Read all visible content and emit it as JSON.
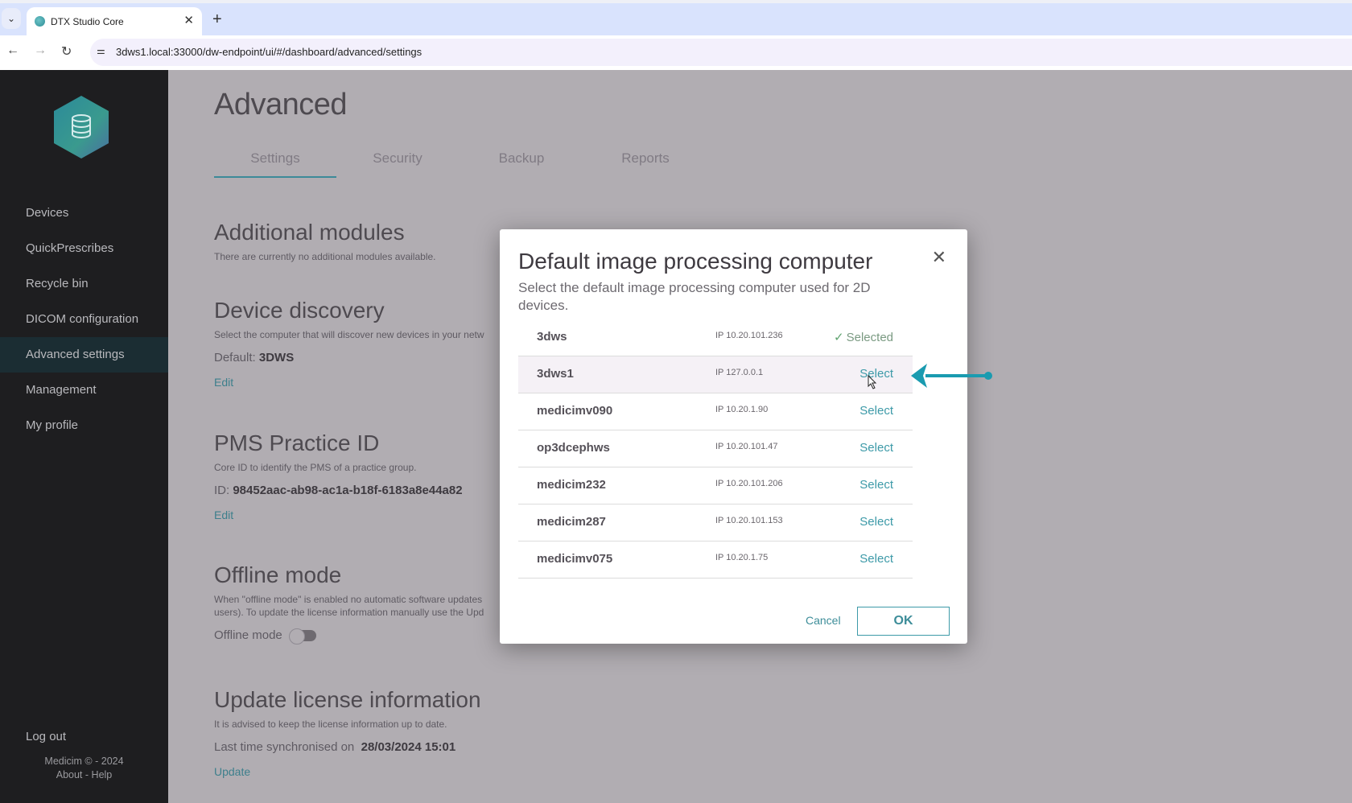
{
  "browser": {
    "tab_title": "DTX Studio Core",
    "url": "3dws1.local:33000/dw-endpoint/ui/#/dashboard/advanced/settings",
    "icons": {
      "tab_list": "chevron-down-icon",
      "close_tab": "close-icon",
      "new_tab": "plus-icon",
      "back": "back-arrow-icon",
      "forward": "forward-arrow-icon",
      "reload": "reload-icon",
      "site_info": "tune-icon"
    }
  },
  "sidebar": {
    "logo": "database-hexagon-logo",
    "items": [
      {
        "label": "Devices",
        "active": false
      },
      {
        "label": "QuickPrescribes",
        "active": false
      },
      {
        "label": "Recycle bin",
        "active": false
      },
      {
        "label": "DICOM configuration",
        "active": false
      },
      {
        "label": "Advanced settings",
        "active": true
      },
      {
        "label": "Management",
        "active": false
      },
      {
        "label": "My profile",
        "active": false
      }
    ],
    "logout": "Log out",
    "copyright": "Medicim © - 2024",
    "about": "About",
    "separator": "-",
    "help": "Help"
  },
  "main": {
    "title": "Advanced",
    "tabs": [
      {
        "label": "Settings",
        "active": true
      },
      {
        "label": "Security",
        "active": false
      },
      {
        "label": "Backup",
        "active": false
      },
      {
        "label": "Reports",
        "active": false
      }
    ],
    "sections": {
      "additional_modules": {
        "title": "Additional modules",
        "description": "There are currently no additional modules available."
      },
      "device_discovery": {
        "title": "Device discovery",
        "description": "Select the computer that will discover new devices in your netw",
        "value_label": "Default:",
        "value": "3DWS",
        "link": "Edit"
      },
      "pms_practice_id": {
        "title": "PMS Practice ID",
        "description": "Core ID to identify the PMS of a practice group.",
        "value_label": "ID:",
        "value": "98452aac-ab98-ac1a-b18f-6183a8e44a82",
        "link": "Edit"
      },
      "offline_mode": {
        "title": "Offline mode",
        "description_line1": "When \"offline mode\" is enabled no automatic software updates",
        "description_line2": "users). To update the license information manually use the Upd",
        "toggle_label": "Offline mode",
        "toggle_on": false
      },
      "update_license": {
        "title": "Update license information",
        "description": "It is advised to keep the license information up to date.",
        "value_label": "Last time synchronised on",
        "value": "28/03/2024 15:01",
        "link": "Update"
      }
    }
  },
  "dialog": {
    "title": "Default image processing computer",
    "subtitle": "Select the default image processing computer used for 2D devices.",
    "close_icon": "close-icon",
    "computers": [
      {
        "name": "3dws",
        "ip": "IP 10.20.101.236",
        "action": "Selected",
        "selected": true
      },
      {
        "name": "3dws1",
        "ip": "IP 127.0.0.1",
        "action": "Select",
        "selected": false,
        "hovered": true
      },
      {
        "name": "medicimv090",
        "ip": "IP 10.20.1.90",
        "action": "Select",
        "selected": false
      },
      {
        "name": "op3dcephws",
        "ip": "IP 10.20.101.47",
        "action": "Select",
        "selected": false
      },
      {
        "name": "medicim232",
        "ip": "IP 10.20.101.206",
        "action": "Select",
        "selected": false
      },
      {
        "name": "medicim287",
        "ip": "IP 10.20.101.153",
        "action": "Select",
        "selected": false
      },
      {
        "name": "medicimv075",
        "ip": "IP 10.20.1.75",
        "action": "Select",
        "selected": false
      }
    ],
    "cancel_label": "Cancel",
    "ok_label": "OK"
  },
  "colors": {
    "accent": "#3d9aa8",
    "sidebar_bg": "#1e1e20",
    "sidebar_active": "#1b2d33",
    "overlay_bg": "#b1adb2",
    "annotation_arrow": "#1a9bb0"
  }
}
